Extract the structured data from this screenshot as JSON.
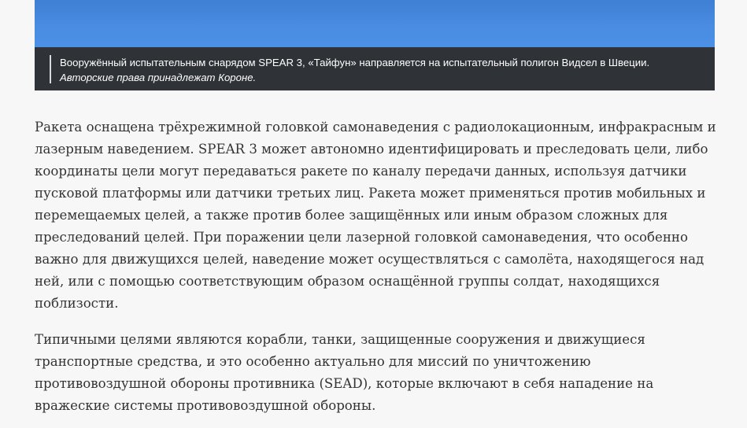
{
  "figure": {
    "caption_main": "Вооружённый испытательным снарядом SPEAR 3, «Тайфун» направляется на испытательный полигон Видсел в Швеции. ",
    "caption_credit": "Авторские права принадлежат Короне."
  },
  "article": {
    "paragraphs": [
      "Ракета оснащена трёхрежимной головкой самонаведения с радиолокационным, инфракрасным и лазерным наведением. SPEAR 3 может автономно идентифицировать и преследовать цели, либо координаты цели могут передаваться ракете по каналу передачи данных, используя датчики пусковой платформы или датчики третьих лиц. Ракета может применяться против мобильных и перемещаемых целей, а также против более защищённых или иным образом сложных для преследований целей. При поражении цели лазерной головкой самонаведения, что особенно важно для движущихся целей, наведение может осуществляться с самолёта, находящегося над ней, или с помощью соответствующим образом оснащённой группы солдат, находящихся поблизости.",
      "Типичными целями являются корабли, танки, защищенные сооружения и движущиеся транспортные средства, и это особенно актуально для миссий по уничтожению противовоздушной обороны противника (SEAD), которые включают в себя нападение на вражеские системы противовоздушной обороны."
    ]
  }
}
